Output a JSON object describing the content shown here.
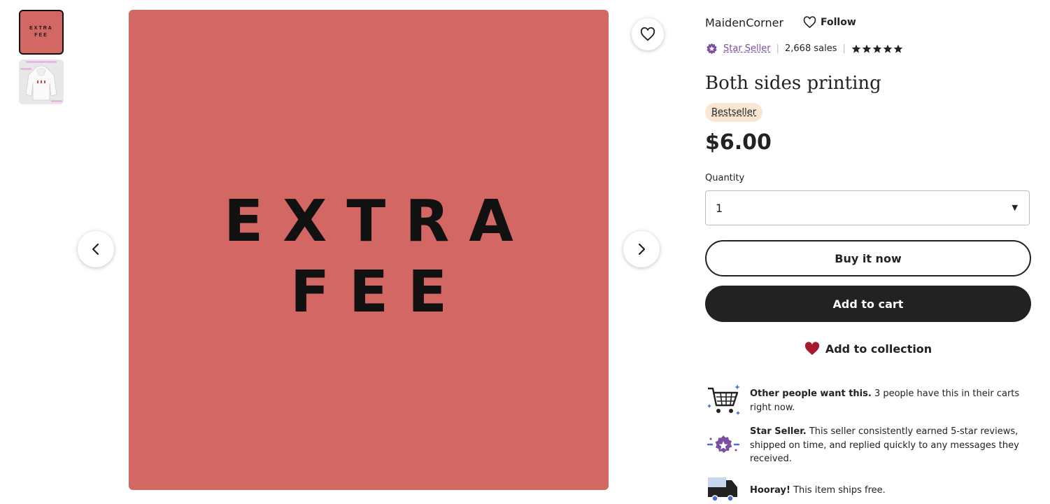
{
  "thumbnails": [
    {
      "label": "EXTRA FEE"
    },
    {
      "label": "hoodie preview"
    }
  ],
  "main_image": {
    "line1": "EXTRA",
    "line2": "FEE",
    "background": "#d36764"
  },
  "shop": {
    "name": "MaidenCorner",
    "follow_label": "Follow",
    "star_seller_label": "Star Seller",
    "sales": "2,668 sales",
    "rating_stars": 5
  },
  "listing": {
    "title": "Both sides printing",
    "badge": "Bestseller",
    "price": "$6.00",
    "quantity_label": "Quantity",
    "quantity_value": "1"
  },
  "actions": {
    "buy_now": "Buy it now",
    "add_to_cart": "Add to cart",
    "add_to_collection": "Add to collection"
  },
  "highlights": [
    {
      "bold": "Other people want this.",
      "text": " 3 people have this in their carts right now."
    },
    {
      "bold": "Star Seller.",
      "text": " This seller consistently earned 5-star reviews, shipped on time, and replied quickly to any messages they received."
    },
    {
      "bold": "Hooray!",
      "text": " This item ships free."
    }
  ],
  "colors": {
    "accent_purple": "#7b4ea3",
    "heart_red": "#a61a2e",
    "dark": "#222222",
    "badge_bg": "#fbe6d3"
  }
}
